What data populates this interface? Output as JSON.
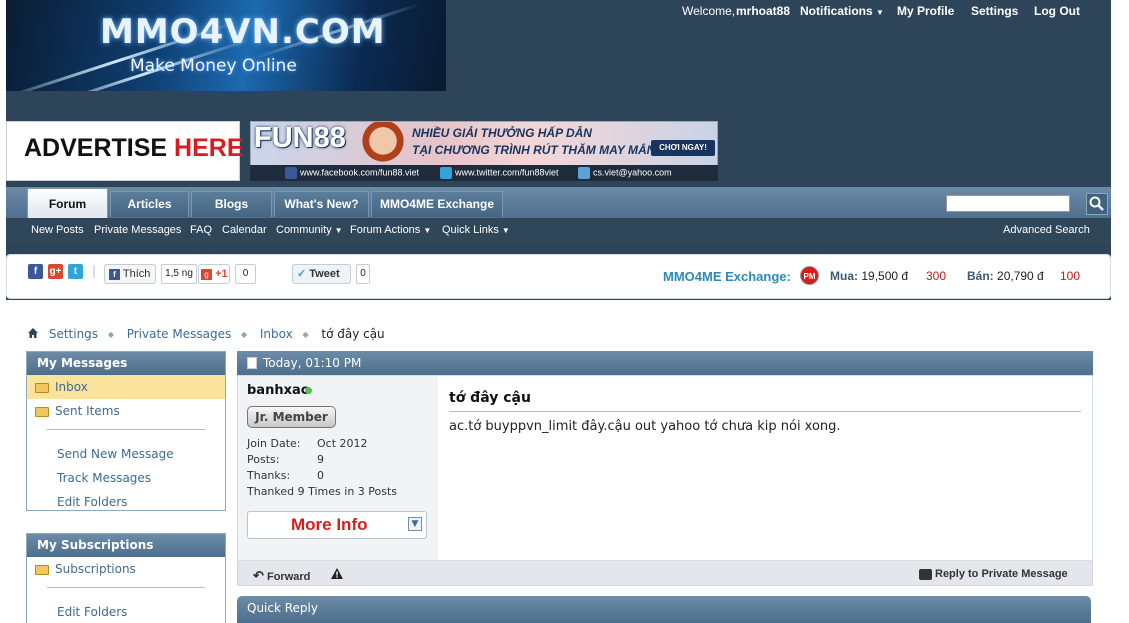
{
  "header": {
    "logo_main": "MMO4VN.COM",
    "logo_sub": "Make Money Online",
    "welcome": "Welcome,",
    "username": "mrhoat88",
    "links": [
      "Notifications",
      "My Profile",
      "Settings",
      "Log Out"
    ]
  },
  "ads": {
    "advertise_prefix": "ADVERTISE ",
    "advertise_highlight": "HERE",
    "banner_brand": "FUN88",
    "banner_line1": "NHIỀU GIẢI THƯỞNG HẤP DẪN",
    "banner_line2": "TẠI CHƯƠNG TRÌNH RÚT THĂM MAY MẮN!",
    "banner_button": "CHƠI NGAY!",
    "banner_links": [
      "www.facebook.com/fun88.viet",
      "www.twitter.com/fun88viet",
      "cs.viet@yahoo.com"
    ]
  },
  "nav": {
    "tabs": [
      "Forum",
      "Articles",
      "Blogs",
      "What's New?",
      "MMO4ME Exchange"
    ],
    "sub": [
      "New Posts",
      "Private Messages",
      "FAQ",
      "Calendar",
      "Community",
      "Forum Actions",
      "Quick Links"
    ],
    "advanced_search": "Advanced Search"
  },
  "social": {
    "like_label": "Thích",
    "like_count": "1,5 ng",
    "gplus_label": "+1",
    "gplus_count": "0",
    "tweet_label": "Tweet",
    "tweet_count": "0"
  },
  "exchange": {
    "label": "MMO4ME Exchange:",
    "pm": "PM",
    "buy_label": "Mua:",
    "buy_price": "19,500 đ",
    "buy_qty": "300",
    "sell_label": "Bán:",
    "sell_price": "20,790 đ",
    "sell_qty": "100"
  },
  "breadcrumb": [
    "Settings",
    "Private Messages",
    "Inbox",
    "tớ đây cậu"
  ],
  "sidebar": {
    "my_messages_title": "My Messages",
    "inbox": "Inbox",
    "sent_items": "Sent Items",
    "send_new": "Send New Message",
    "track": "Track Messages",
    "edit_folders": "Edit Folders",
    "subs_title": "My Subscriptions",
    "subscriptions": "Subscriptions",
    "subs_edit_folders": "Edit Folders"
  },
  "post": {
    "date": "Today, 01:10 PM",
    "author": "banhxac",
    "rank": "Jr. Member",
    "join_label": "Join Date:",
    "join_value": "Oct 2012",
    "posts_label": "Posts:",
    "posts_value": "9",
    "thanks_label": "Thanks:",
    "thanks_value": "0",
    "thanked": "Thanked 9 Times in 3 Posts",
    "more_info": "More Info",
    "title": "tớ đây cậu",
    "body": "ac.tớ buyppvn_limit đây.cậu out yahoo tớ chưa kip nói xong.",
    "forward": "Forward",
    "reply": "Reply to Private Message"
  },
  "quick_reply": "Quick Reply"
}
